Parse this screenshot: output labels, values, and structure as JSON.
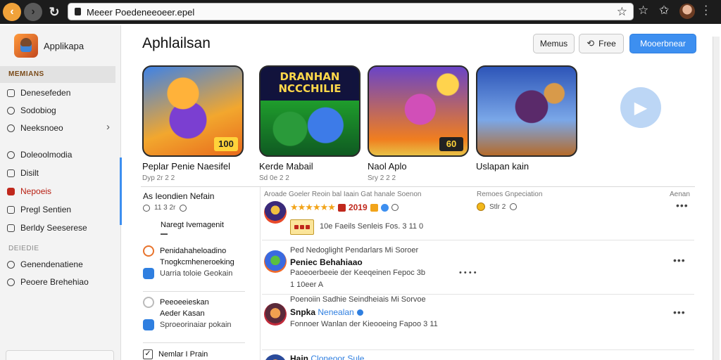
{
  "browser": {
    "url": "Meeer Poedeneeoeer.epel",
    "back_icon": "arrow-left-icon",
    "forward_icon": "arrow-right-icon",
    "reload_icon": "reload-icon",
    "lock_icon": "lock-icon",
    "star_icon": "star-icon"
  },
  "sidebar": {
    "app_name": "Applikapa",
    "section_main": "MEMIANS",
    "items": [
      {
        "label": "Denesefeden"
      },
      {
        "label": "Sodobiog"
      },
      {
        "label": "Neeksnoeo"
      },
      {
        "label": "Doleoolmodia"
      },
      {
        "label": "Disilt"
      },
      {
        "label": "Nepoeis"
      },
      {
        "label": "Pregl Sentien"
      },
      {
        "label": "Berldy Seeserese"
      }
    ],
    "section_secondary": "DEIEDIE",
    "items_secondary": [
      {
        "label": "Genendenatiene"
      },
      {
        "label": "Peoere Brehehiao"
      }
    ]
  },
  "main": {
    "title": "Aphlailsan",
    "buttons": {
      "menus": "Memus",
      "free": "Free",
      "primary": "Mooerbnear"
    },
    "games": [
      {
        "title": "Peplar Penie Naesifel",
        "sub": "Dyp 2r 2 2"
      },
      {
        "title": "Kerde Mabail",
        "sub": "Sd 0e 2 2"
      },
      {
        "title": "Naol Aplo",
        "sub": "Sry 2 2 2"
      },
      {
        "title": "Uslapan kain",
        "sub": ""
      }
    ],
    "game_banner": "DRANHAN NCCCHILIE",
    "game_badge_1": "100",
    "game_badge_3": "60"
  },
  "left_panel": {
    "title": "As Ieondien Nefain",
    "meta": "11 3 2r",
    "sub_title": "Naregt Ivemagenit",
    "items": [
      {
        "line1": "Penidahaheloadino",
        "line2": "Tnogkcmheneroeking",
        "line3": "Uarria toloie Geokain"
      },
      {
        "line1": "Peeoeeieskan",
        "line2": "Aeder Kasan",
        "line3": "Sproeorinaiar pokain"
      },
      {
        "line1": "Nemlar I Prain"
      }
    ]
  },
  "feed": {
    "header_left": "Aroade Goeler Reoin bal Iaain Gat hanale Soenon",
    "header_mid": "Remoes Gnpeciation",
    "header_right": "Aenan",
    "posts": [
      {
        "year": "2019",
        "mid_text": "Stlr 2",
        "detail": "10e Faeils Senleis Fos. 3 11 0"
      },
      {
        "top_line": "Ped Nedoglight Pendarlars Mi Soroer",
        "name": "Peniec Behahiaao",
        "line1": "Paoeoerbeeie der Keeqeinen Fepoc 3b",
        "line2": "1 10eer A",
        "mid_text": "• • • •"
      },
      {
        "top_line": "Poenoiin Sadhie Seindheiais Mi Sorvoe",
        "name": "Snpka",
        "name_link": "Nenealan",
        "line1": "Fonnoer Wanlan der Kieooeing Fapoo 3 11"
      },
      {
        "name": "Hain",
        "name_link": "Cloneoor Sule"
      }
    ]
  }
}
